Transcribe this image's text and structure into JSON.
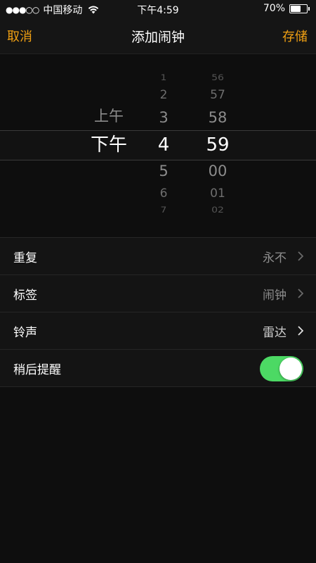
{
  "status_bar": {
    "signal": "●●●○○",
    "carrier": "中国移动",
    "time": "下午4:59",
    "battery_text": "70%",
    "battery_level": 0.7
  },
  "nav": {
    "cancel_label": "取消",
    "title": "添加闹钟",
    "save_label": "存储"
  },
  "picker": {
    "ampm": {
      "above": "上午",
      "selected": "下午"
    },
    "hours": {
      "above": [
        "1",
        "2",
        "3"
      ],
      "selected": "4",
      "below": [
        "5",
        "6",
        "7"
      ]
    },
    "minutes": {
      "above": [
        "56",
        "57",
        "58"
      ],
      "selected": "59",
      "below": [
        "00",
        "01",
        "02"
      ]
    }
  },
  "settings": {
    "repeat": {
      "label": "重复",
      "value": "永不"
    },
    "alarm_label": {
      "label": "标签",
      "value": "闹钟"
    },
    "sound": {
      "label": "铃声",
      "value": "雷达"
    },
    "snooze": {
      "label": "稍后提醒",
      "on": true
    }
  },
  "colors": {
    "accent": "#f0a013",
    "toggle_on": "#4cd964",
    "background": "#0e0e0e"
  }
}
